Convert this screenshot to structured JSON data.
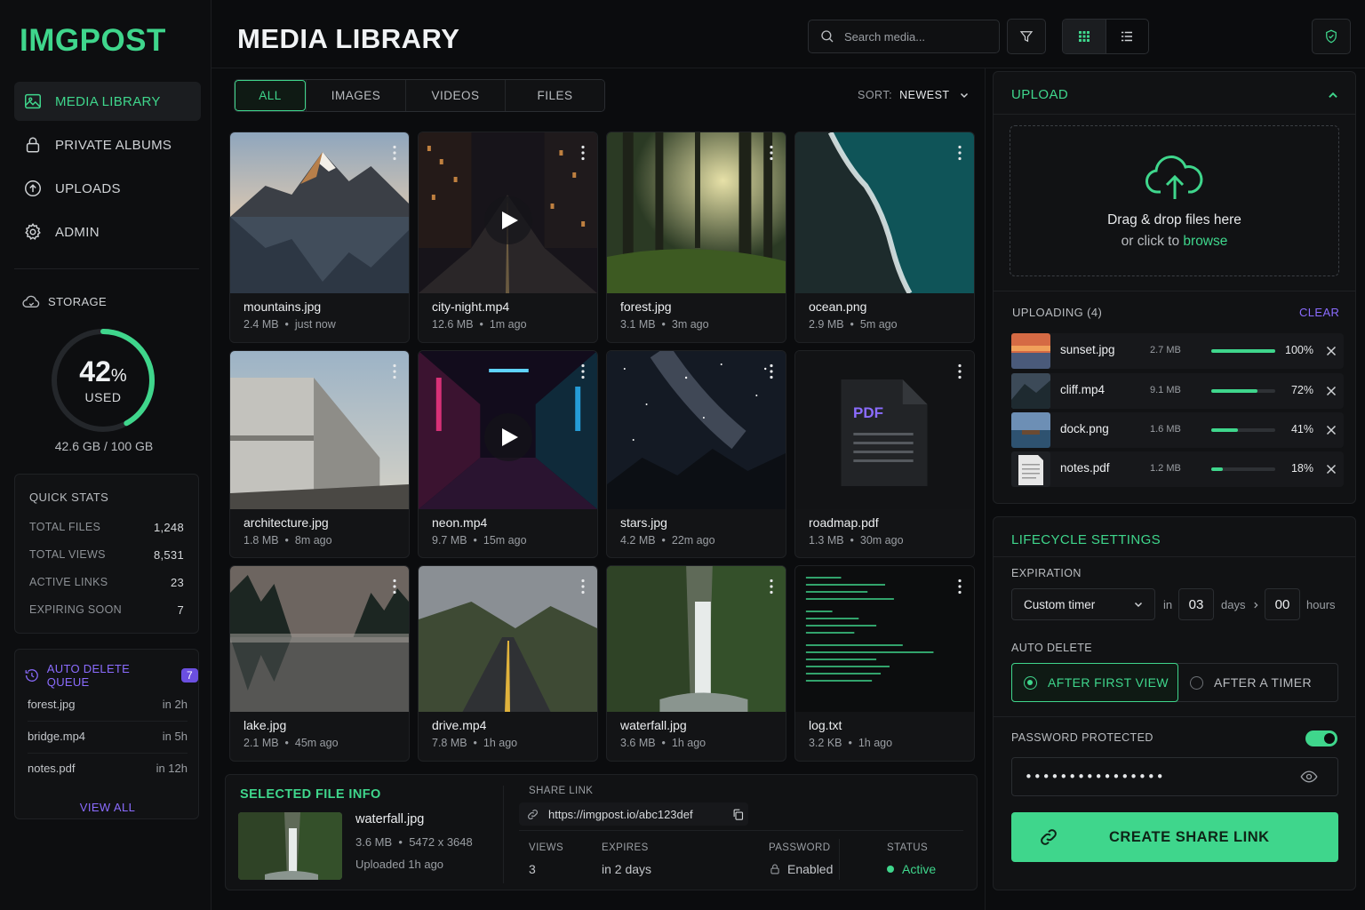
{
  "app": {
    "logo": "IMGPOST",
    "page_title": "MEDIA LIBRARY"
  },
  "colors": {
    "accent": "#3fd68c",
    "secondary": "#8b6cff",
    "background": "#0b0c0e",
    "panel": "#111214"
  },
  "sidebar": {
    "items": [
      {
        "label": "MEDIA LIBRARY",
        "icon": "image-icon",
        "active": true
      },
      {
        "label": "PRIVATE ALBUMS",
        "icon": "lock-icon",
        "active": false
      },
      {
        "label": "UPLOADS",
        "icon": "upload-icon",
        "active": false
      },
      {
        "label": "ADMIN",
        "icon": "gear-icon",
        "active": false
      }
    ],
    "storage": {
      "label": "STORAGE",
      "percent": 42,
      "percent_symbol": "%",
      "used_label": "USED",
      "amount": "42.6 GB / 100 GB"
    },
    "quick_stats": {
      "title": "QUICK STATS",
      "rows": [
        {
          "label": "TOTAL FILES",
          "value": "1,248"
        },
        {
          "label": "TOTAL VIEWS",
          "value": "8,531"
        },
        {
          "label": "ACTIVE LINKS",
          "value": "23"
        },
        {
          "label": "EXPIRING SOON",
          "value": "7"
        }
      ]
    },
    "auto_delete_queue": {
      "title": "AUTO DELETE QUEUE",
      "count": "7",
      "items": [
        {
          "name": "forest.jpg",
          "when": "in 2h"
        },
        {
          "name": "bridge.mp4",
          "when": "in 5h"
        },
        {
          "name": "notes.pdf",
          "when": "in 12h"
        }
      ],
      "view_all": "VIEW ALL"
    }
  },
  "header": {
    "search_placeholder": "Search media...",
    "filter_icon": "filter-icon",
    "grid_view_icon": "grid-icon",
    "list_view_icon": "list-icon",
    "shield_icon": "shield-check-icon"
  },
  "tabs": [
    {
      "label": "ALL",
      "active": true
    },
    {
      "label": "IMAGES",
      "active": false
    },
    {
      "label": "VIDEOS",
      "active": false
    },
    {
      "label": "FILES",
      "active": false
    }
  ],
  "sort": {
    "label": "SORT:",
    "value": "NEWEST"
  },
  "media": [
    {
      "name": "mountains.jpg",
      "size": "2.4 MB",
      "time": "just now",
      "type": "image"
    },
    {
      "name": "city-night.mp4",
      "size": "12.6 MB",
      "time": "1m ago",
      "type": "video"
    },
    {
      "name": "forest.jpg",
      "size": "3.1 MB",
      "time": "3m ago",
      "type": "image"
    },
    {
      "name": "ocean.png",
      "size": "2.9 MB",
      "time": "5m ago",
      "type": "image"
    },
    {
      "name": "architecture.jpg",
      "size": "1.8 MB",
      "time": "8m ago",
      "type": "image"
    },
    {
      "name": "neon.mp4",
      "size": "9.7 MB",
      "time": "15m ago",
      "type": "video"
    },
    {
      "name": "stars.jpg",
      "size": "4.2 MB",
      "time": "22m ago",
      "type": "image"
    },
    {
      "name": "roadmap.pdf",
      "size": "1.3 MB",
      "time": "30m ago",
      "type": "pdf",
      "badge": "PDF"
    },
    {
      "name": "lake.jpg",
      "size": "2.1 MB",
      "time": "45m ago",
      "type": "image"
    },
    {
      "name": "drive.mp4",
      "size": "7.8 MB",
      "time": "1h ago",
      "type": "video"
    },
    {
      "name": "waterfall.jpg",
      "size": "3.6 MB",
      "time": "1h ago",
      "type": "image"
    },
    {
      "name": "log.txt",
      "size": "3.2 KB",
      "time": "1h ago",
      "type": "text"
    }
  ],
  "selected": {
    "title": "SELECTED FILE INFO",
    "name": "waterfall.jpg",
    "size": "3.6 MB",
    "dimensions": "5472 x 3648",
    "uploaded": "Uploaded 1h ago",
    "share_label": "SHARE LINK",
    "share_url": "https://imgpost.io/abc123def",
    "stats": [
      {
        "label": "VIEWS",
        "value": "3"
      },
      {
        "label": "EXPIRES",
        "value": "in 2 days"
      },
      {
        "label": "PASSWORD",
        "value": "Enabled"
      },
      {
        "label": "STATUS",
        "value": "Active"
      }
    ]
  },
  "upload": {
    "title": "UPLOAD",
    "drop_line1": "Drag & drop files here",
    "drop_line2_prefix": "or click to",
    "drop_link": "browse",
    "queue_label": "UPLOADING (4)",
    "clear": "CLEAR",
    "items": [
      {
        "name": "sunset.jpg",
        "size": "2.7 MB",
        "percent": 100,
        "percent_label": "100%"
      },
      {
        "name": "cliff.mp4",
        "size": "9.1 MB",
        "percent": 72,
        "percent_label": "72%"
      },
      {
        "name": "dock.png",
        "size": "1.6 MB",
        "percent": 41,
        "percent_label": "41%"
      },
      {
        "name": "notes.pdf",
        "size": "1.2 MB",
        "percent": 18,
        "percent_label": "18%"
      }
    ]
  },
  "lifecycle": {
    "title": "LIFECYCLE SETTINGS",
    "expiration_label": "EXPIRATION",
    "expiration_value": "Custom timer",
    "in_label": "in",
    "days_value": "03",
    "days_label": "days",
    "hours_value": "00",
    "hours_label": "hours",
    "auto_delete_label": "AUTO DELETE",
    "options": [
      {
        "label": "AFTER FIRST VIEW",
        "selected": true
      },
      {
        "label": "AFTER A TIMER",
        "selected": false
      }
    ],
    "password_label": "PASSWORD PROTECTED",
    "password_enabled": true,
    "password_value": "••••••••••••••••",
    "cta": "CREATE SHARE LINK"
  }
}
